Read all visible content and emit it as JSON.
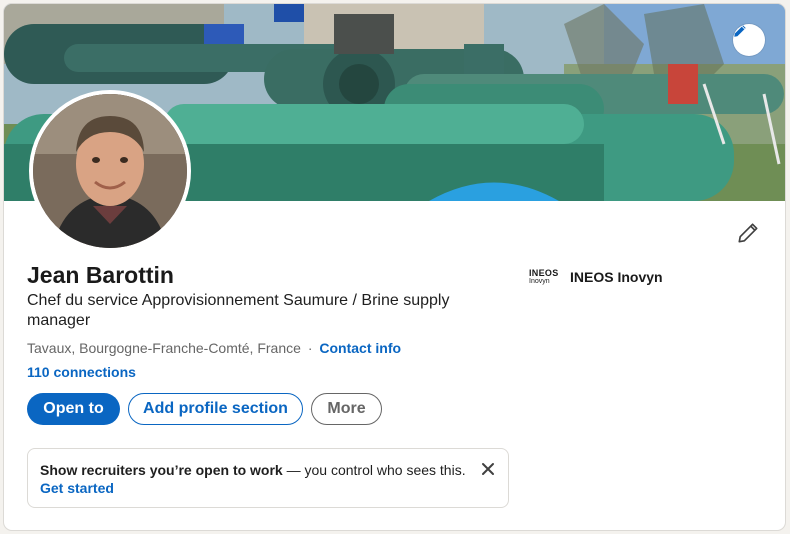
{
  "profile": {
    "name": "Jean Barottin",
    "headline": "Chef du service Approvisionnement Saumure / Brine supply manager",
    "location": "Tavaux, Bourgogne-Franche-Comté, France",
    "separator": "·",
    "contact_info_label": "Contact info",
    "connections_label": "110 connections"
  },
  "actions": {
    "open_to_label": "Open to",
    "add_section_label": "Add profile section",
    "more_label": "More"
  },
  "notice": {
    "bold_text": "Show recruiters you’re open to work",
    "rest_text": " — you control who sees this.",
    "cta_label": "Get started"
  },
  "company": {
    "logo_line1": "INEOS",
    "logo_line2": "Inovyn",
    "name": "INEOS Inovyn"
  },
  "icons": {
    "banner_edit": "pencil-icon",
    "profile_edit": "pencil-icon",
    "notice_close": "close-icon"
  },
  "colors": {
    "accent": "#0a66c2",
    "pipe_green": "#3e9a82",
    "text_primary": "#1a1a1a",
    "text_muted": "#666666"
  }
}
